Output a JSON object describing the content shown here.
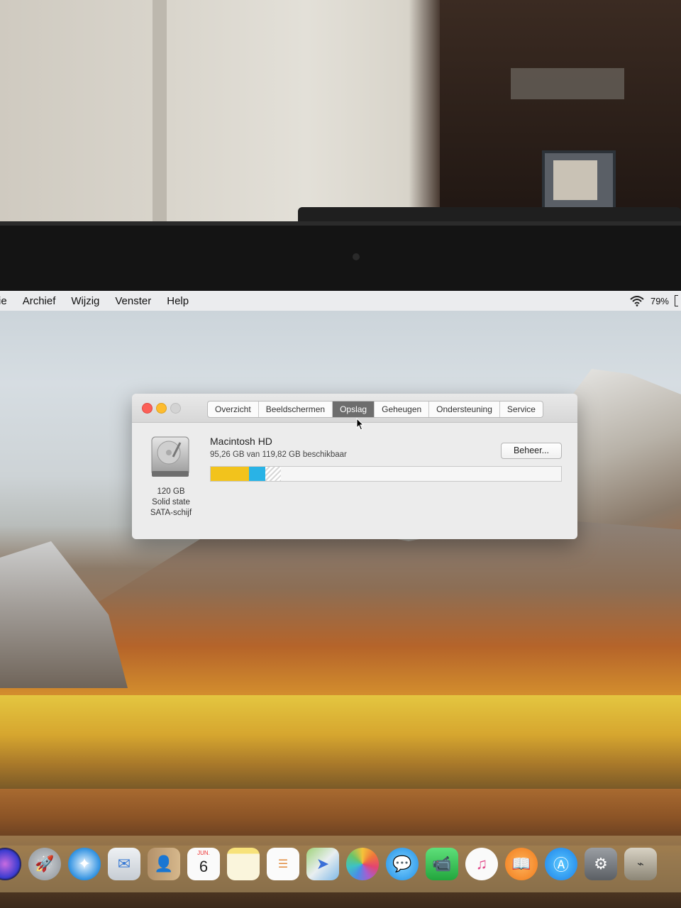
{
  "menubar": {
    "items": [
      "ie",
      "Archief",
      "Wijzig",
      "Venster",
      "Help"
    ],
    "battery": "79%"
  },
  "window": {
    "tabs": [
      "Overzicht",
      "Beeldschermen",
      "Opslag",
      "Geheugen",
      "Ondersteuning",
      "Service"
    ],
    "active_tab": "Opslag",
    "disk": {
      "capacity": "120 GB",
      "type_line1": "Solid state",
      "type_line2": "SATA-schijf"
    },
    "volume": {
      "name": "Macintosh HD",
      "available": "95,26 GB van 119,82 GB beschikbaar"
    },
    "manage_button": "Beheer...",
    "storage_usage": [
      {
        "category": "apps",
        "fraction": 0.11,
        "color": "#f2c31c"
      },
      {
        "category": "other",
        "fraction": 0.045,
        "color": "#29b3e6"
      },
      {
        "category": "purgeable",
        "fraction": 0.045,
        "color": "#e0e0e0"
      },
      {
        "category": "free",
        "fraction": 0.8,
        "color": "#f6f6f6"
      }
    ]
  },
  "dock": {
    "icons": [
      "siri-icon",
      "launchpad-icon",
      "safari-icon",
      "mail-icon",
      "contacts-icon",
      "calendar-icon",
      "notes-icon",
      "reminders-icon",
      "maps-icon",
      "photos-icon",
      "messages-icon",
      "facetime-icon",
      "itunes-icon",
      "ibooks-icon",
      "app-store-icon",
      "system-preferences-icon",
      "utility-icon"
    ],
    "calendar_month": "JUN.",
    "calendar_day": "6"
  }
}
